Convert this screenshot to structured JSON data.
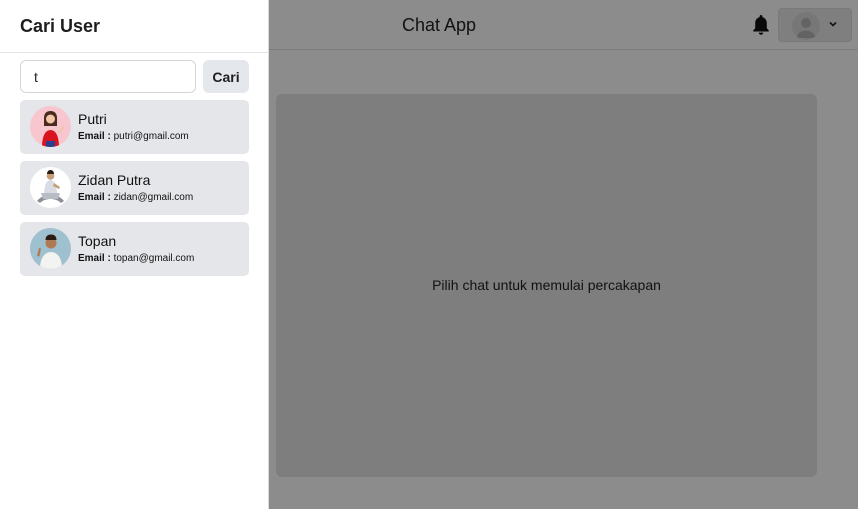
{
  "header": {
    "app_title": "Chat App",
    "bell_icon": "bell-icon",
    "account_icon": "user-avatar-icon",
    "chevron_icon": "chevron-down-icon"
  },
  "main": {
    "empty_message": "Pilih chat untuk memulai percakapan"
  },
  "drawer": {
    "title": "Cari User",
    "search": {
      "value": "t",
      "button_label": "Cari"
    },
    "email_label": "Email :",
    "users": [
      {
        "name": "Putri",
        "email": "putri@gmail.com"
      },
      {
        "name": "Zidan Putra",
        "email": "zidan@gmail.com"
      },
      {
        "name": "Topan",
        "email": "topan@gmail.com"
      }
    ]
  },
  "colors": {
    "overlay": "#000000",
    "list_item_bg": "#e5e6ea",
    "button_bg": "#e4e7ec"
  }
}
